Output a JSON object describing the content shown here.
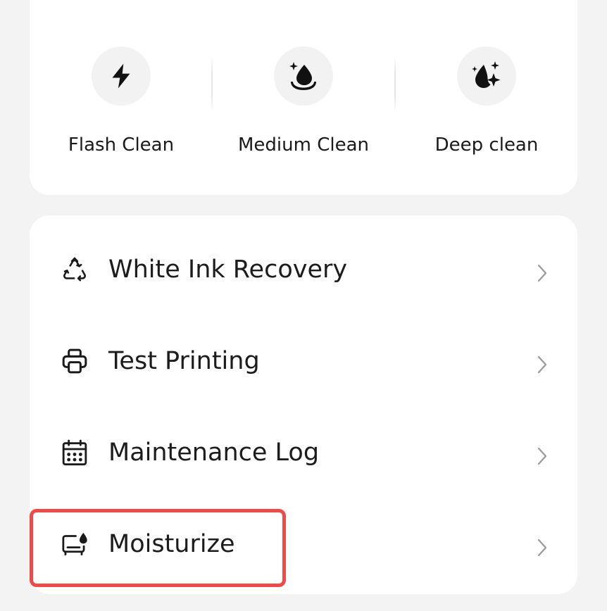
{
  "clean_options": [
    {
      "label": "Flash Clean",
      "icon": "lightning-bolt-icon"
    },
    {
      "label": "Medium Clean",
      "icon": "water-drop-sparkle-icon"
    },
    {
      "label": "Deep clean",
      "icon": "drop-stars-icon"
    }
  ],
  "menu": [
    {
      "label": "White Ink Recovery",
      "icon": "recycle-icon"
    },
    {
      "label": "Test Printing",
      "icon": "printer-icon"
    },
    {
      "label": "Maintenance Log",
      "icon": "calendar-icon"
    },
    {
      "label": "Moisturize",
      "icon": "moisturize-icon"
    }
  ],
  "colors": {
    "background": "#f3f3f3",
    "card": "#ffffff",
    "icon_circle": "#f2f2f2",
    "highlight": "#ef4a4a",
    "chevron": "#9a9a9a"
  }
}
